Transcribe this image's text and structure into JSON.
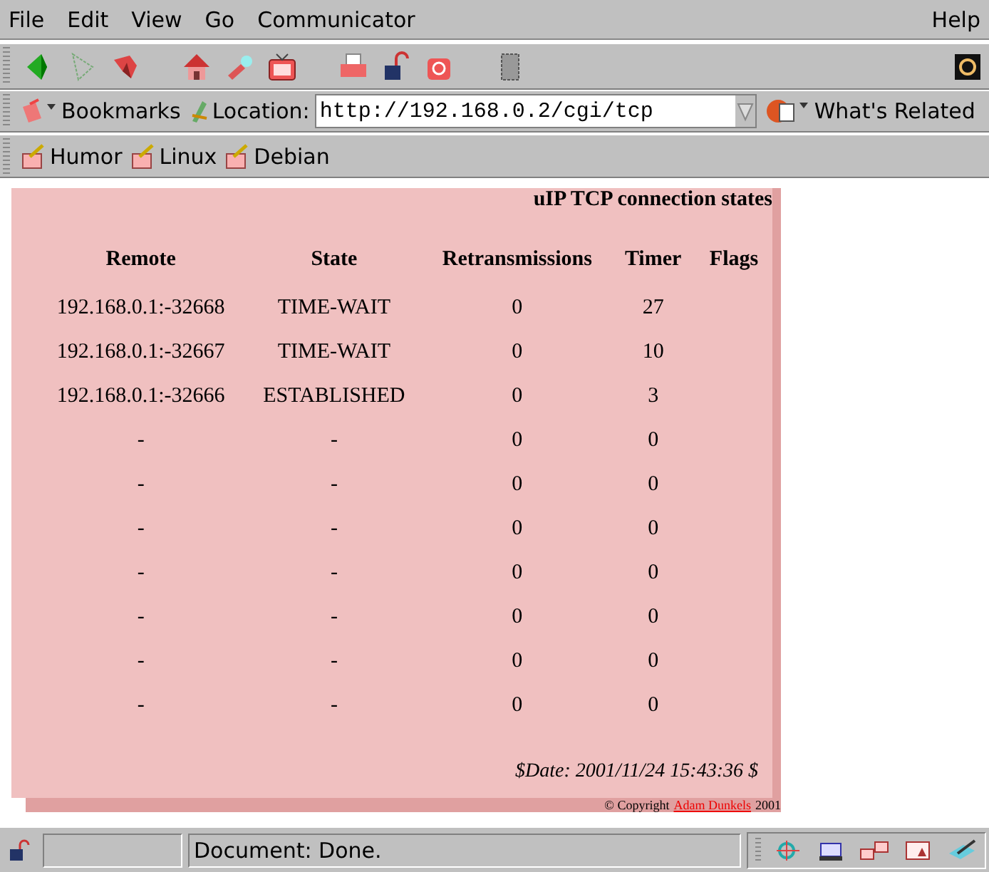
{
  "menu": {
    "left": [
      "File",
      "Edit",
      "View",
      "Go",
      "Communicator"
    ],
    "right": "Help"
  },
  "location_bar": {
    "bookmarks": "Bookmarks",
    "label": "Location:",
    "url": "http://192.168.0.2/cgi/tcp",
    "related": "What's Related"
  },
  "personal_toolbar": [
    "Humor",
    "Linux",
    "Debian"
  ],
  "page": {
    "title": "uIP TCP connection states",
    "table": {
      "columns": [
        "Remote",
        "State",
        "Retransmissions",
        "Timer",
        "Flags"
      ],
      "rows": [
        [
          "192.168.0.1:-32668",
          "TIME-WAIT",
          "0",
          "27"
        ],
        [
          "192.168.0.1:-32667",
          "TIME-WAIT",
          "0",
          "10"
        ],
        [
          "192.168.0.1:-32666",
          "ESTABLISHED",
          "0",
          "3"
        ],
        [
          "-",
          "-",
          "0",
          "0"
        ],
        [
          "-",
          "-",
          "0",
          "0"
        ],
        [
          "-",
          "-",
          "0",
          "0"
        ],
        [
          "-",
          "-",
          "0",
          "0"
        ],
        [
          "-",
          "-",
          "0",
          "0"
        ],
        [
          "-",
          "-",
          "0",
          "0"
        ],
        [
          "-",
          "-",
          "0",
          "0"
        ]
      ]
    },
    "date": "$Date: 2001/11/24 15:43:36 $",
    "copyright": "© Copyright",
    "author_link": "Adam Dunkels",
    "year": "2001"
  },
  "status_bar": {
    "text": "Document: Done."
  }
}
